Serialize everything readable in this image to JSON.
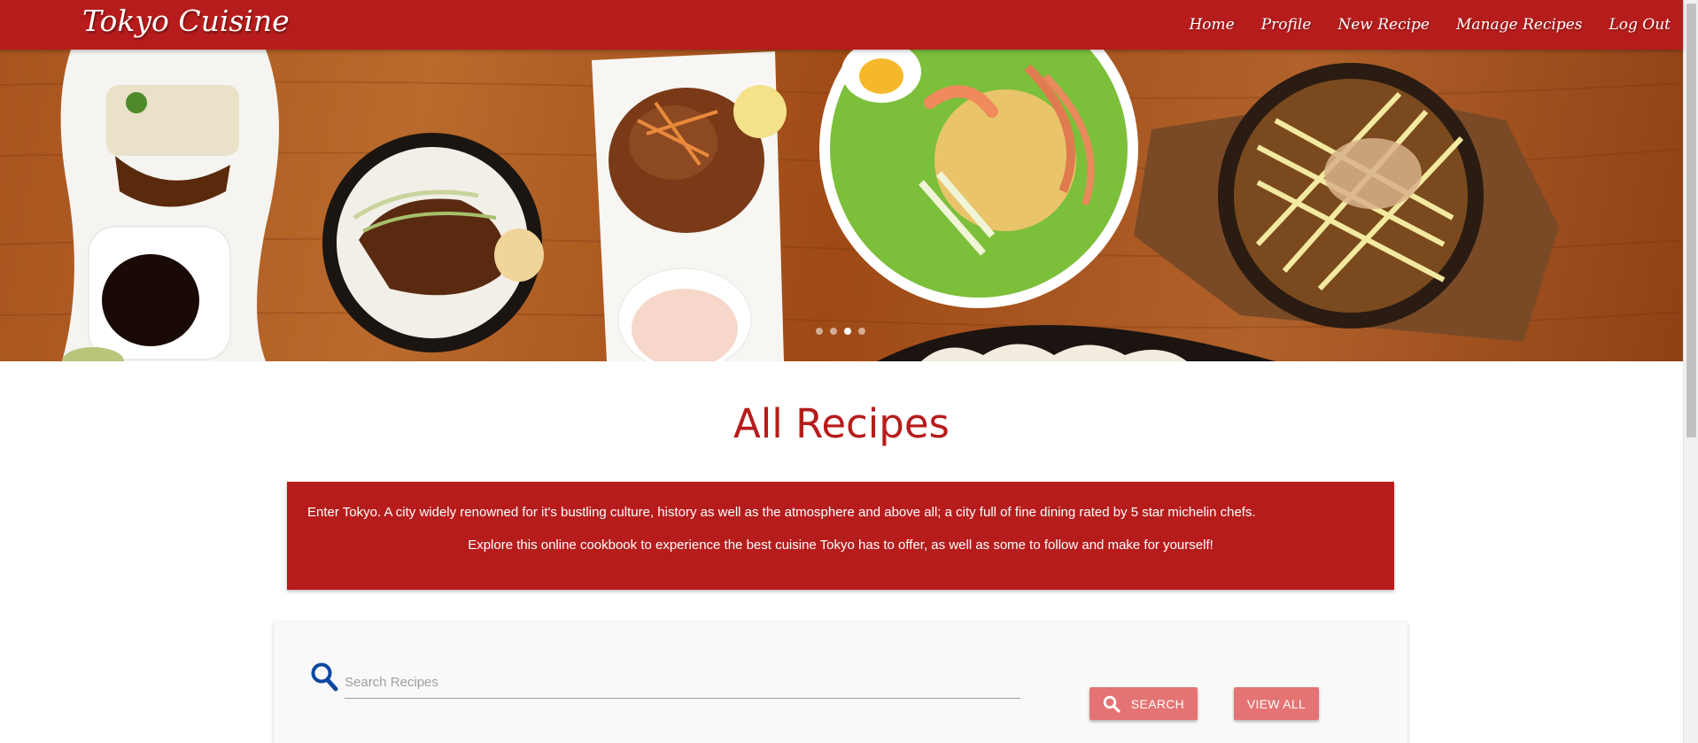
{
  "navbar": {
    "brand": "Tokyo Cuisine",
    "links": [
      "Home",
      "Profile",
      "New Recipe",
      "Manage Recipes",
      "Log Out"
    ]
  },
  "hero": {
    "carousel_dots": 4,
    "active_slide": 3
  },
  "main": {
    "title": "All Recipes",
    "intro": {
      "paragraph1": "Enter Tokyo. A city widely renowned for it's bustling culture, history as well as the atmosphere and above all; a city full of fine dining rated by 5 star michelin chefs.",
      "paragraph2": "Explore this online cookbook to experience the best cuisine Tokyo has to offer, as well as some to follow and make for yourself!"
    },
    "search": {
      "placeholder": "Search Recipes",
      "value": "",
      "search_button": "SEARCH",
      "view_all_button": "VIEW ALL"
    }
  },
  "colors": {
    "primary": "#b71c1c",
    "button": "#e57373",
    "search_icon": "#0d47a1"
  },
  "icons": {
    "search": "search-icon"
  }
}
